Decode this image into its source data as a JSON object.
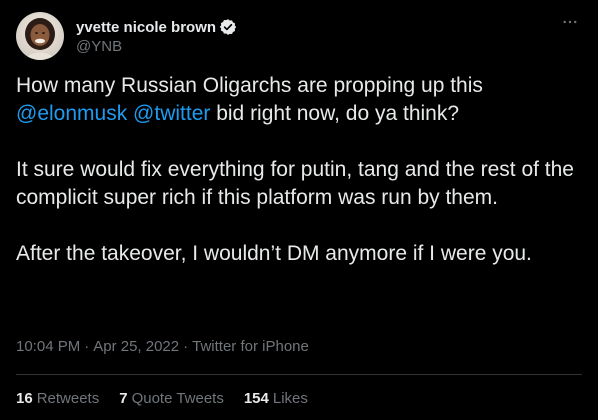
{
  "author": {
    "display_name": "yvette nicole brown",
    "handle": "@YNB",
    "verified": true,
    "avatar_icon": "profile-photo"
  },
  "menu": {
    "icon": "more-horizontal-icon"
  },
  "tweet": {
    "paragraphs": [
      {
        "segments": [
          {
            "text": "How many Russian Oligarchs are propping up this ",
            "type": "text"
          },
          {
            "text": "@elonmusk",
            "type": "mention"
          },
          {
            "text": " ",
            "type": "text"
          },
          {
            "text": "@twitter",
            "type": "mention"
          },
          {
            "text": " bid right now, do ya think?",
            "type": "text"
          }
        ]
      },
      {
        "segments": [
          {
            "text": "It sure would fix everything for putin, tang and the rest of the complicit super rich if this platform was run by them.",
            "type": "text"
          }
        ]
      },
      {
        "segments": [
          {
            "text": "After the takeover, I wouldn’t DM anymore if I were you.",
            "type": "text"
          }
        ]
      }
    ]
  },
  "meta": {
    "time": "10:04 PM",
    "separator": "·",
    "date": "Apr 25, 2022",
    "source": "Twitter for iPhone"
  },
  "stats": {
    "retweets_count": "16",
    "retweets_label": "Retweets",
    "quotes_count": "7",
    "quotes_label": "Quote Tweets",
    "likes_count": "154",
    "likes_label": "Likes"
  },
  "colors": {
    "background": "#000000",
    "text": "#e7e9ea",
    "secondary": "#71767b",
    "link": "#1d9bf0",
    "divider": "#2f3336"
  }
}
